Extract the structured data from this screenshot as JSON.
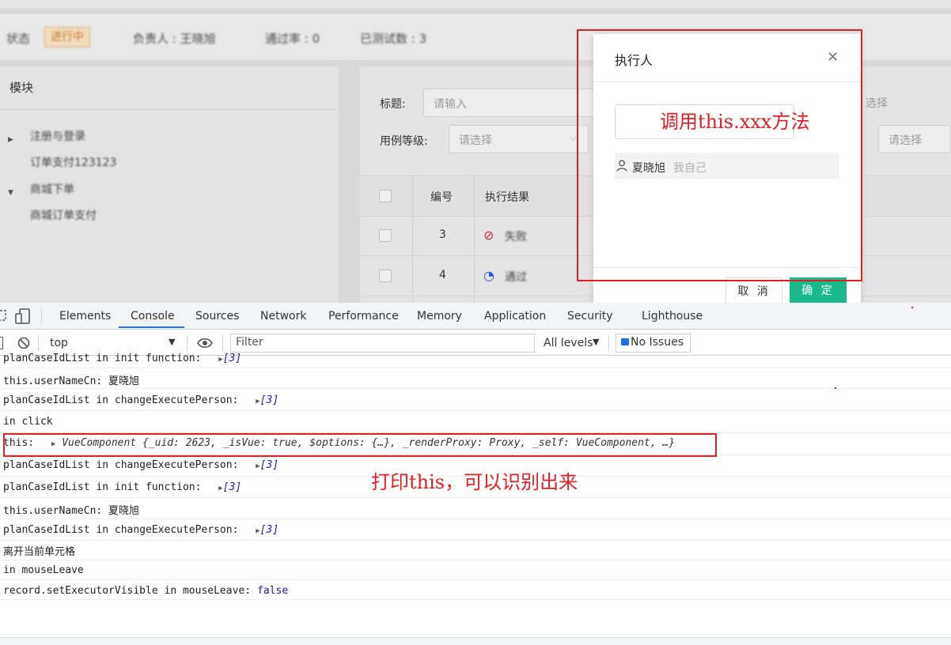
{
  "filter_bar": {
    "items": [
      "状态",
      "进行中",
      "负责人 : 王晓旭",
      "通过率 : 0",
      "已测试数 : 3"
    ]
  },
  "left_panel": {
    "title": "模块",
    "tree": [
      "注册与登录",
      "订单支付123123",
      "商城下单",
      "商城订单支付"
    ]
  },
  "search_form": {
    "title_label": "标题:",
    "title_placeholder": "请输入",
    "level_label": "用例等级:",
    "level_placeholder": "请选择",
    "right_placeholder_1": "选择",
    "right_placeholder_2": "请选择"
  },
  "table": {
    "headers": [
      "编号",
      "执行结果"
    ],
    "rows": [
      {
        "num": "3",
        "result": "失败"
      },
      {
        "num": "4",
        "result": "通过"
      }
    ]
  },
  "modal": {
    "title": "执行人",
    "option_name": "夏晓旭",
    "option_note": "我自己",
    "cancel_label": "取 消",
    "ok_label": "确 定"
  },
  "annotations": {
    "modal_note": "调用this.xxx方法",
    "console_note": "打印this，可以识别出来"
  },
  "devtools": {
    "tabs": [
      "Elements",
      "Console",
      "Sources",
      "Network",
      "Performance",
      "Memory",
      "Application",
      "Security",
      "Lighthouse"
    ],
    "active_tab": "Console",
    "context": "top",
    "filter_placeholder": "Filter",
    "levels": "All levels",
    "issues": "No Issues"
  },
  "console": {
    "l1_text": "planCaseIdList in init function:",
    "l1_val": "[3]",
    "l2_text": "this.userNameCn:  夏晓旭",
    "l3_text": "planCaseIdList in changeExecutePerson:",
    "l3_val": "[3]",
    "l4_text": "in click",
    "l5_label": "this:",
    "l5_obj": "VueComponent {_uid: 2623, _isVue: true, $options: {…}, _renderProxy: Proxy, _self: VueComponent, …}",
    "l6_text": "planCaseIdList in changeExecutePerson:",
    "l6_val": "[3]",
    "l7_text": "planCaseIdList in init function:",
    "l7_val": "[3]",
    "l8_text": "this.userNameCn:  夏晓旭",
    "l9_text": "planCaseIdList in changeExecutePerson:",
    "l9_val": "[3]",
    "l10_text": "离开当前单元格",
    "l11_text": "in mouseLeave",
    "l12_text": "record.setExecutorVisible in mouseLeave:",
    "l12_val": "false"
  },
  "colors": {
    "annotation_red": "#e02020",
    "primary_green": "#19b98c",
    "devtools_blue": "#1a73e8"
  }
}
